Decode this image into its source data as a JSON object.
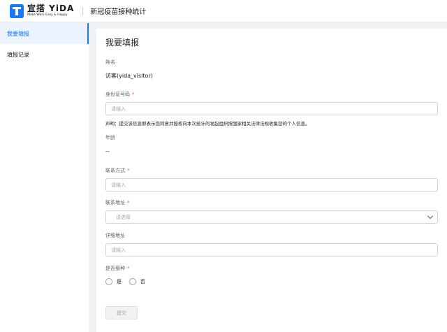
{
  "header": {
    "brand_name": "宜搭 YiDA",
    "brand_slogan": "Make Work Easy & Happy",
    "app_title": "新冠疫苗接种统计"
  },
  "sidebar": {
    "items": [
      {
        "label": "我要填报",
        "active": true
      },
      {
        "label": "填报记录",
        "active": false
      }
    ]
  },
  "form": {
    "title": "我要填报",
    "name": {
      "label": "姓名",
      "value": "访客(yida_visitor)"
    },
    "id_card": {
      "label": "身份证号码",
      "required": "*",
      "placeholder": "请输入",
      "notice": "声明：提交该信息即表示您同意并授权向本次统计的发起组织按国家相关法律法规收集您的个人信息。"
    },
    "age": {
      "label": "年龄",
      "value": "--"
    },
    "contact": {
      "label": "联系方式",
      "required": "*",
      "placeholder": "请输入"
    },
    "address": {
      "label": "联系地址",
      "required": "*",
      "placeholder": "请选择"
    },
    "detail_address": {
      "label": "详细地址",
      "placeholder": "请输入"
    },
    "vaccinated": {
      "label": "是否接种",
      "required": "*",
      "options": [
        "是",
        "否"
      ]
    },
    "submit_label": "提交"
  },
  "colors": {
    "accent": "#1677ff",
    "required": "#ff5219"
  }
}
